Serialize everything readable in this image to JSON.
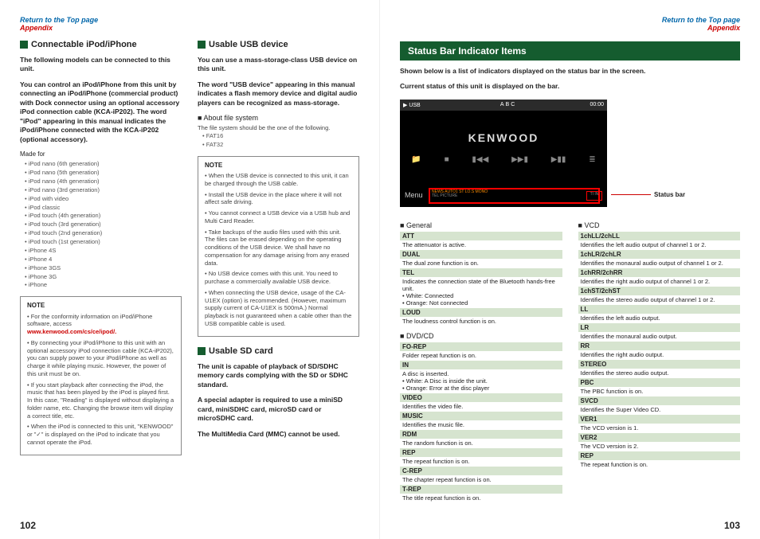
{
  "topLink": {
    "return": "Return to the Top page",
    "appendix": "Appendix"
  },
  "leftPage": {
    "col1": {
      "head": "Connectable iPod/iPhone",
      "intro": "The following models can be connected to this unit.",
      "desc": "You can control an iPod/iPhone from this unit by connecting an iPod/iPhone (commercial product) with Dock connector using an optional accessory iPod connection cable (KCA-iP202). The word \"iPod\" appearing in this manual indicates the iPod/iPhone connected with the KCA-iP202 (optional accessory).",
      "made": "Made for",
      "models": [
        "iPod nano (6th generation)",
        "iPod nano (5th generation)",
        "iPod nano (4th generation)",
        "iPod nano (3rd generation)",
        "iPod with video",
        "iPod classic",
        "iPod touch (4th generation)",
        "iPod touch (3rd generation)",
        "iPod touch (2nd generation)",
        "iPod touch (1st generation)",
        "iPhone 4S",
        "iPhone 4",
        "iPhone 3GS",
        "iPhone 3G",
        "iPhone"
      ],
      "noteTitle": "NOTE",
      "notes": [
        "For the conformity information on iPod/iPhone software, access",
        "By connecting your iPod/iPhone to this unit with an optional accessory iPod connection cable (KCA-iP202), you can supply power to your iPod/iPhone as well as charge it while playing music. However, the power of this unit must be on.",
        "If you start playback after connecting the iPod, the music that has been played by the iPod is played first.\nIn this case, \"Reading\" is displayed without displaying a folder name, etc. Changing the browse item will display a correct title, etc.",
        "When the iPod is connected to this unit, \"KENWOOD\" or \"✓\" is displayed on the iPod to indicate that you cannot operate the iPod."
      ],
      "noteLink": "www.kenwood.com/cs/ce/ipod/"
    },
    "col2": {
      "head1": "Usable USB device",
      "desc1": "You can use a mass-storage-class USB device on this unit.",
      "desc1b": "The word \"USB device\" appearing in this manual indicates a flash memory device and digital audio players can be recognized as mass-storage.",
      "sub1": "About file system",
      "sub1desc": "The file system should be the one of the following.",
      "fs": [
        "FAT16",
        "FAT32"
      ],
      "noteTitle": "NOTE",
      "notes": [
        "When the USB device is connected to this unit, it can be charged through the USB cable.",
        "Install the USB device in the place where it will not affect safe driving.",
        "You cannot connect a USB device via a USB hub and Multi Card Reader.",
        "Take backups of the audio files used with this unit. The files can be erased depending on the operating conditions of the USB device. We shall have no compensation for any damage arising from any erased data.",
        "No USB device comes with this unit. You need to purchase a commercially available USB device.",
        "When connecting the USB device, usage of the CA-U1EX (option) is recommended. (However, maximum supply current of CA-U1EX is 500mA.) Normal playback is not guaranteed when a cable other than the USB compatible cable is used."
      ],
      "head2": "Usable SD card",
      "sd1": "The unit is capable of playback of SD/SDHC memory cards complying with the SD or SDHC standard.",
      "sd2": "A special adapter is required to use a miniSD card, miniSDHC card, microSD card or microSDHC card.",
      "sd3": "The MultiMedia Card (MMC) cannot be used."
    },
    "pageNum": "102"
  },
  "rightPage": {
    "title": "Status Bar Indicator Items",
    "intro": "Shown below is a list of indicators displayed on the status bar in the screen.",
    "intro2": "Current status of this unit is displayed on the bar.",
    "callout": "Status bar",
    "screenshot": {
      "usb": "USB",
      "abc": "ABC",
      "time": "00:00",
      "brand": "KENWOOD",
      "menu": "Menu",
      "bar1": "NEWS   AUTO1   ST   LO.S   MONO",
      "bar2": "TEL   PICTURE",
      "bar3": "TI  IN"
    },
    "col1": {
      "sec1": "General",
      "items1": [
        {
          "t": "ATT",
          "d": "The attenuator is active."
        },
        {
          "t": "DUAL",
          "d": "The dual zone function is on."
        },
        {
          "t": "TEL",
          "d": "Indicates the connection state of the Bluetooth hands-free unit.\n• White: Connected\n• Orange: Not connected"
        },
        {
          "t": "LOUD",
          "d": "The loudness control function is on."
        }
      ],
      "sec2": "DVD/CD",
      "items2": [
        {
          "t": "FO-REP",
          "d": "Folder repeat function is on."
        },
        {
          "t": "IN",
          "d": "A disc is inserted.\n• White: A Disc is inside the unit.\n• Orange: Error at the disc player"
        },
        {
          "t": "VIDEO",
          "d": "Identifies the video file."
        },
        {
          "t": "MUSIC",
          "d": "Identifies the music file."
        },
        {
          "t": "RDM",
          "d": "The random function is on."
        },
        {
          "t": "REP",
          "d": "The repeat function is on."
        },
        {
          "t": "C-REP",
          "d": "The chapter repeat function is on."
        },
        {
          "t": "T-REP",
          "d": "The title repeat function is on."
        }
      ]
    },
    "col2": {
      "sec1": "VCD",
      "items1": [
        {
          "t": "1chLL/2chLL",
          "d": "Identifies the left audio output of channel 1 or 2."
        },
        {
          "t": "1chLR/2chLR",
          "d": "Identifies the monaural audio output of channel 1 or 2."
        },
        {
          "t": "1chRR/2chRR",
          "d": "Identifies the right audio output of channel 1 or 2."
        },
        {
          "t": "1chST/2chST",
          "d": "Identifies the stereo audio output of channel 1 or 2."
        },
        {
          "t": "LL",
          "d": "Identifies the left audio output."
        },
        {
          "t": "LR",
          "d": "Identifies the monaural audio output."
        },
        {
          "t": "RR",
          "d": "Identifies the right audio output."
        },
        {
          "t": "STEREO",
          "d": "Identifies the stereo audio output."
        },
        {
          "t": "PBC",
          "d": "The PBC function is on."
        },
        {
          "t": "SVCD",
          "d": "Identifies the Super Video CD."
        },
        {
          "t": "VER1",
          "d": "The VCD version is 1."
        },
        {
          "t": "VER2",
          "d": "The VCD version is 2."
        },
        {
          "t": "REP",
          "d": "The repeat function is on."
        }
      ]
    },
    "pageNum": "103"
  }
}
